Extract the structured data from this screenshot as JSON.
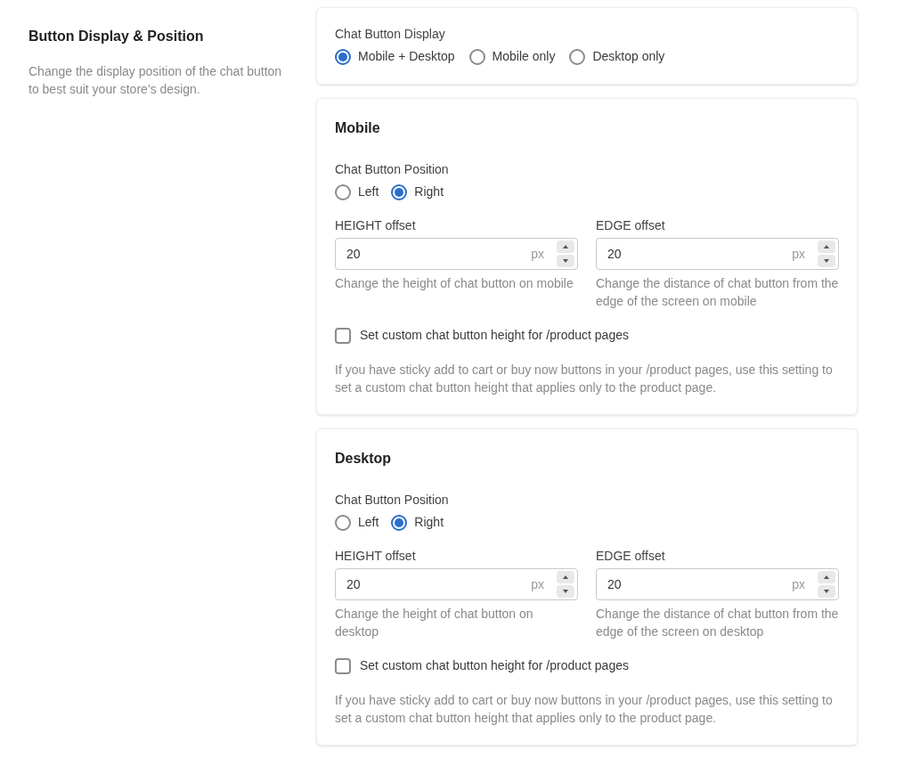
{
  "intro": {
    "title": "Button Display & Position",
    "description": "Change the display position of the chat button to best suit your store’s design."
  },
  "display": {
    "label": "Chat Button Display",
    "options": [
      {
        "label": "Mobile + Desktop",
        "selected": true
      },
      {
        "label": "Mobile only",
        "selected": false
      },
      {
        "label": "Desktop only",
        "selected": false
      }
    ]
  },
  "sections": [
    {
      "title": "Mobile",
      "position": {
        "label": "Chat Button Position",
        "options": [
          {
            "label": "Left",
            "selected": false
          },
          {
            "label": "Right",
            "selected": true
          }
        ]
      },
      "fields": [
        {
          "label": "HEIGHT offset",
          "value": "20",
          "unit": "px",
          "help": "Change the height of chat button on mobile"
        },
        {
          "label": "EDGE offset",
          "value": "20",
          "unit": "px",
          "help": "Change the distance of chat button from the edge of the screen on mobile"
        }
      ],
      "checkbox": {
        "label": "Set custom chat button height for /product pages",
        "checked": false
      },
      "note": "If you have sticky add to cart or buy now buttons in your /product pages, use this setting to set a custom chat button height that applies only to the product page."
    },
    {
      "title": "Desktop",
      "position": {
        "label": "Chat Button Position",
        "options": [
          {
            "label": "Left",
            "selected": false
          },
          {
            "label": "Right",
            "selected": true
          }
        ]
      },
      "fields": [
        {
          "label": "HEIGHT offset",
          "value": "20",
          "unit": "px",
          "help": "Change the height of chat button on desktop"
        },
        {
          "label": "EDGE offset",
          "value": "20",
          "unit": "px",
          "help": "Change the distance of chat button from the edge of the screen on desktop"
        }
      ],
      "checkbox": {
        "label": "Set custom chat button height for /product pages",
        "checked": false
      },
      "note": "If you have sticky add to cart or buy now buttons in your /product pages, use this setting to set a custom chat button height that applies only to the product page."
    }
  ]
}
